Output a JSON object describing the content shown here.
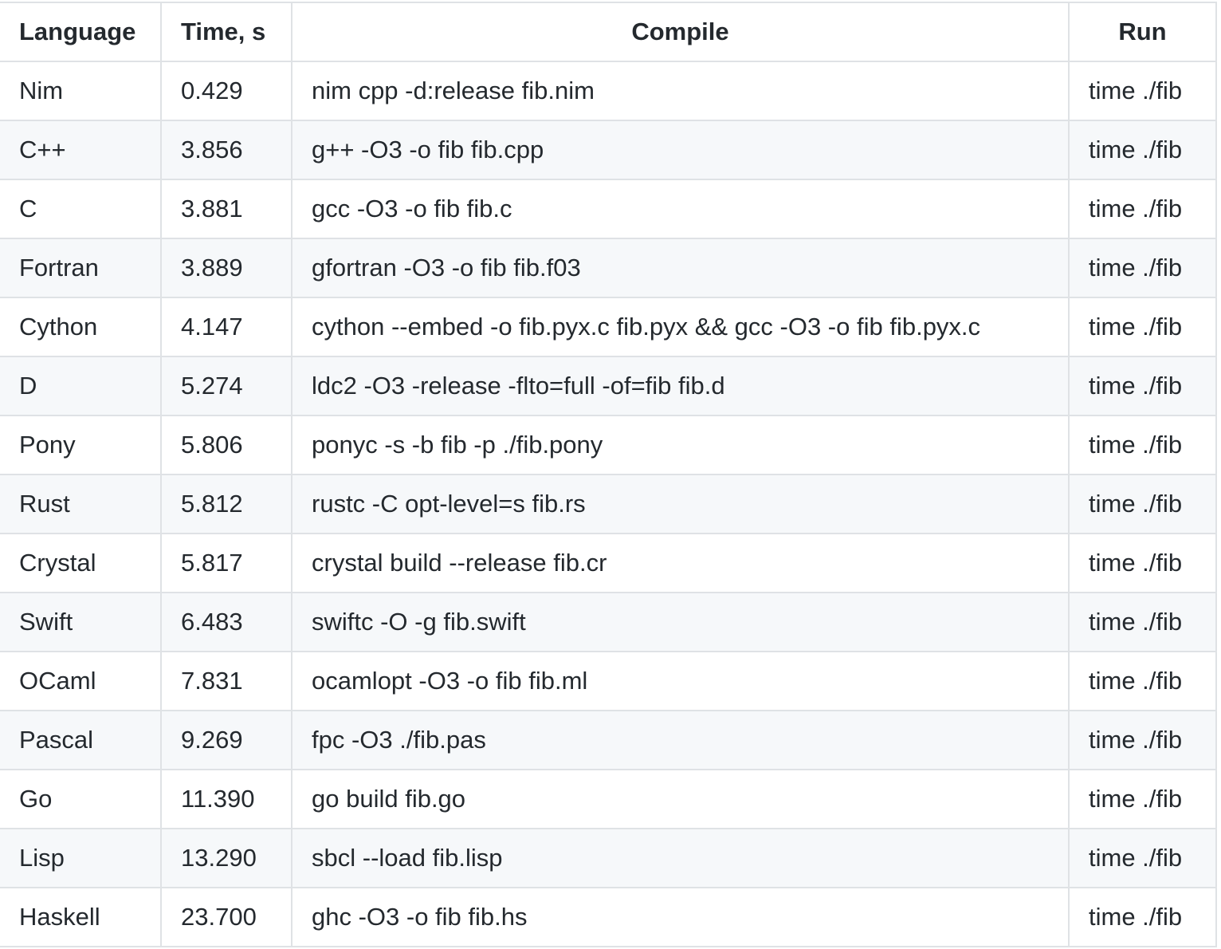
{
  "table": {
    "headers": [
      "Language",
      "Time, s",
      "Compile",
      "Run"
    ],
    "rows": [
      [
        "Nim",
        "0.429",
        "nim cpp -d:release fib.nim",
        "time ./fib"
      ],
      [
        "C++",
        "3.856",
        "g++ -O3 -o fib fib.cpp",
        "time ./fib"
      ],
      [
        "C",
        "3.881",
        "gcc -O3 -o fib fib.c",
        "time ./fib"
      ],
      [
        "Fortran",
        "3.889",
        "gfortran -O3 -o fib fib.f03",
        "time ./fib"
      ],
      [
        "Cython",
        "4.147",
        "cython --embed -o fib.pyx.c fib.pyx && gcc -O3 -o fib fib.pyx.c",
        "time ./fib"
      ],
      [
        "D",
        "5.274",
        "ldc2 -O3 -release -flto=full -of=fib fib.d",
        "time ./fib"
      ],
      [
        "Pony",
        "5.806",
        "ponyc -s -b fib -p ./fib.pony",
        "time ./fib"
      ],
      [
        "Rust",
        "5.812",
        "rustc -C opt-level=s fib.rs",
        "time ./fib"
      ],
      [
        "Crystal",
        "5.817",
        "crystal build --release fib.cr",
        "time ./fib"
      ],
      [
        "Swift",
        "6.483",
        "swiftc -O -g fib.swift",
        "time ./fib"
      ],
      [
        "OCaml",
        "7.831",
        "ocamlopt -O3 -o fib fib.ml",
        "time ./fib"
      ],
      [
        "Pascal",
        "9.269",
        "fpc -O3 ./fib.pas",
        "time ./fib"
      ],
      [
        "Go",
        "11.390",
        "go build fib.go",
        "time ./fib"
      ],
      [
        "Lisp",
        "13.290",
        "sbcl --load fib.lisp",
        "time ./fib"
      ],
      [
        "Haskell",
        "23.700",
        "ghc -O3 -o fib fib.hs",
        "time ./fib"
      ]
    ]
  }
}
